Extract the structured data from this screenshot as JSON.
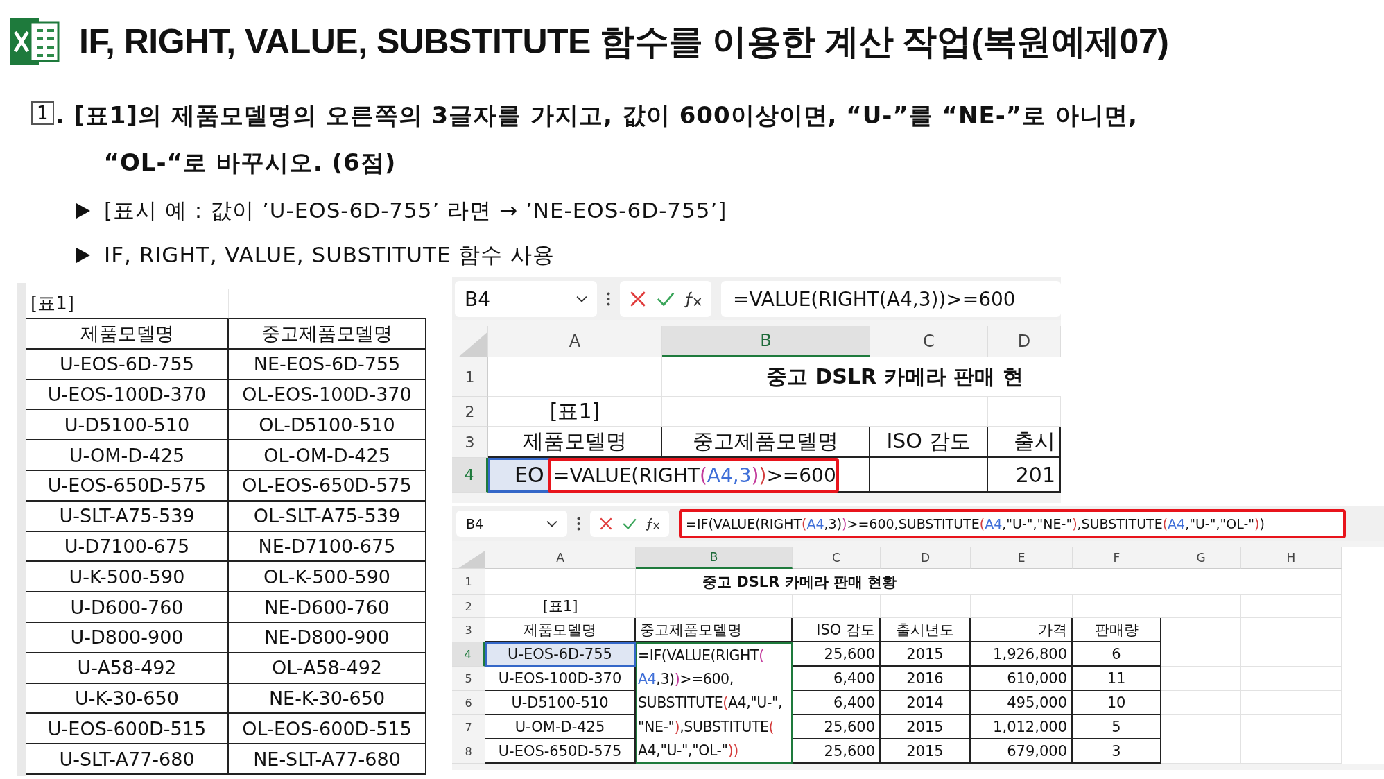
{
  "title": "IF, RIGHT, VALUE, SUBSTITUTE 함수를 이용한 계산 작업(복원예제07)",
  "question": {
    "number": "1",
    "lines": [
      ". [표1]의 제품모델명의 오른쪽의 3글자를 가지고, 값이 600이상이면, “U-”를 “NE-”로 아니면,",
      "“OL-“로 바꾸시오. (6점)"
    ]
  },
  "bullets": [
    "[표시 예 : 값이 ’U-EOS-6D-755’ 라면 → ’NE-EOS-6D-755’]",
    "IF, RIGHT, VALUE, SUBSTITUTE 함수 사용"
  ],
  "result_table": {
    "label": "[표1]",
    "columns": [
      "제품모델명",
      "중고제품모델명"
    ],
    "rows": [
      [
        "U-EOS-6D-755",
        "NE-EOS-6D-755"
      ],
      [
        "U-EOS-100D-370",
        "OL-EOS-100D-370"
      ],
      [
        "U-D5100-510",
        "OL-D5100-510"
      ],
      [
        "U-OM-D-425",
        "OL-OM-D-425"
      ],
      [
        "U-EOS-650D-575",
        "OL-EOS-650D-575"
      ],
      [
        "U-SLT-A75-539",
        "OL-SLT-A75-539"
      ],
      [
        "U-D7100-675",
        "NE-D7100-675"
      ],
      [
        "U-K-500-590",
        "OL-K-500-590"
      ],
      [
        "U-D600-760",
        "NE-D600-760"
      ],
      [
        "U-D800-900",
        "NE-D800-900"
      ],
      [
        "U-A58-492",
        "OL-A58-492"
      ],
      [
        "U-K-30-650",
        "NE-K-30-650"
      ],
      [
        "U-EOS-600D-515",
        "OL-EOS-600D-515"
      ],
      [
        "U-SLT-A77-680",
        "NE-SLT-A77-680"
      ]
    ]
  },
  "excel_views": [
    {
      "name_box": "B4",
      "formula_bar": {
        "highlighted": false,
        "segments": [
          {
            "text": "=VALUE(RIGHT(A4,3))>=600"
          }
        ]
      },
      "columns": [
        {
          "label": "A",
          "selected": false
        },
        {
          "label": "B",
          "selected": true
        },
        {
          "label": "C",
          "selected": false
        },
        {
          "label": "D",
          "selected": false
        }
      ],
      "rows": [
        {
          "number": "1",
          "kind": "title",
          "selected": false,
          "cells": [
            null,
            "중고 DSLR 카메라 판매 현"
          ]
        },
        {
          "number": "2",
          "kind": "plain",
          "selected": false,
          "cells": [
            "[표1]",
            null,
            null,
            null
          ]
        },
        {
          "number": "3",
          "kind": "header",
          "selected": false,
          "cells": [
            "제품모델명",
            "중고제품모델명",
            "ISO 감도",
            "출시"
          ]
        },
        {
          "number": "4",
          "kind": "data",
          "selected": true,
          "cells": [
            "EO",
            null,
            null,
            "201"
          ]
        }
      ],
      "editor": {
        "highlighted": true,
        "lines": [
          [
            {
              "text": "=VALUE(RIGHT"
            },
            {
              "text": "(",
              "color": "#c2399b"
            },
            {
              "text": "A4,3",
              "color": "#3f6fd8"
            },
            {
              "text": ")",
              "color": "#c2399b"
            },
            {
              "text": ")",
              "color": "#d33b3b"
            },
            {
              "text": ">=600"
            }
          ]
        ]
      }
    },
    {
      "name_box": "B4",
      "formula_bar": {
        "highlighted": true,
        "segments": [
          {
            "text": "=IF(VALUE(RIGHT"
          },
          {
            "text": "(",
            "color": "#d33b3b"
          },
          {
            "text": "A4",
            "color": "#3f6fd8"
          },
          {
            "text": ",3)"
          },
          {
            "text": ")",
            "color": "#c2399b"
          },
          {
            "text": ">=600,SUBSTITUTE"
          },
          {
            "text": "(",
            "color": "#d33b3b"
          },
          {
            "text": "A4",
            "color": "#3f6fd8"
          },
          {
            "text": ",\"U-\",\"NE-\""
          },
          {
            "text": ")",
            "color": "#d33b3b"
          },
          {
            "text": ",SUBSTITUTE"
          },
          {
            "text": "(",
            "color": "#d33b3b"
          },
          {
            "text": "A4",
            "color": "#3f6fd8"
          },
          {
            "text": ",\"U-\",\"OL-\""
          },
          {
            "text": ")",
            "color": "#d33b3b"
          },
          {
            "text": ")"
          }
        ]
      },
      "columns": [
        {
          "label": "A",
          "selected": false
        },
        {
          "label": "B",
          "selected": true
        },
        {
          "label": "C",
          "selected": false
        },
        {
          "label": "D",
          "selected": false
        },
        {
          "label": "E",
          "selected": false
        },
        {
          "label": "F",
          "selected": false
        },
        {
          "label": "G",
          "selected": false
        },
        {
          "label": "H",
          "selected": false
        }
      ],
      "rows": [
        {
          "number": "1",
          "kind": "title",
          "selected": false,
          "cells": [
            null,
            "중고 DSLR 카메라 판매 현황"
          ]
        },
        {
          "number": "2",
          "kind": "plain",
          "selected": false,
          "cells": [
            "[표1]",
            null,
            null,
            null,
            null,
            null,
            null,
            null
          ]
        },
        {
          "number": "3",
          "kind": "header",
          "selected": false,
          "cells": [
            "제품모델명",
            "중고제품모델명",
            "ISO 감도",
            "출시년도",
            "가격",
            "판매량",
            null,
            null
          ]
        },
        {
          "number": "4",
          "kind": "data",
          "selected": true,
          "cells": [
            "U-EOS-6D-755",
            null,
            "25,600",
            "2015",
            "1,926,800",
            "6",
            null,
            null
          ]
        },
        {
          "number": "5",
          "kind": "data",
          "selected": false,
          "cells": [
            "U-EOS-100D-370",
            null,
            "6,400",
            "2016",
            "610,000",
            "11",
            null,
            null
          ]
        },
        {
          "number": "6",
          "kind": "data",
          "selected": false,
          "cells": [
            "U-D5100-510",
            null,
            "6,400",
            "2014",
            "495,000",
            "10",
            null,
            null
          ]
        },
        {
          "number": "7",
          "kind": "data",
          "selected": false,
          "cells": [
            "U-OM-D-425",
            null,
            "25,600",
            "2015",
            "1,012,000",
            "5",
            null,
            null
          ]
        },
        {
          "number": "8",
          "kind": "data",
          "selected": false,
          "cells": [
            "U-EOS-650D-575",
            null,
            "25,600",
            "2015",
            "679,000",
            "3",
            null,
            null
          ]
        }
      ],
      "editor": {
        "highlighted": false,
        "lines": [
          [
            {
              "text": "=IF(VALUE(RIGHT"
            },
            {
              "text": "(",
              "color": "#c2399b"
            }
          ],
          [
            {
              "text": "A4",
              "color": "#3f6fd8"
            },
            {
              "text": ",3)"
            },
            {
              "text": ")",
              "color": "#c2399b"
            },
            {
              "text": ">=600,"
            }
          ],
          [
            {
              "text": "SUBSTITUTE"
            },
            {
              "text": "(",
              "color": "#d33b3b"
            },
            {
              "text": "A4,\"U-\","
            }
          ],
          [
            {
              "text": "\"NE-\""
            },
            {
              "text": ")",
              "color": "#d33b3b"
            },
            {
              "text": ",SUBSTITUTE"
            },
            {
              "text": "(",
              "color": "#d33b3b"
            }
          ],
          [
            {
              "text": "A4,\"U-\",\"OL-\""
            },
            {
              "text": "))",
              "color": "#d33b3b"
            }
          ]
        ]
      }
    }
  ]
}
